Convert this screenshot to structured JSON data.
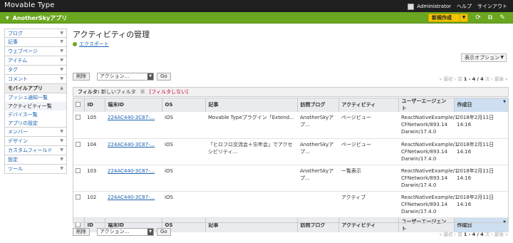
{
  "app": {
    "title": "Movable Type"
  },
  "user": {
    "name": "Administrator",
    "help": "ヘルプ",
    "signout": "サインアウト"
  },
  "blog": {
    "name": "AnotherSkyアプリ",
    "new_button": "新規作成"
  },
  "sidebar": {
    "items": [
      {
        "label": "ブログ"
      },
      {
        "label": "記事"
      },
      {
        "label": "ウェブページ"
      },
      {
        "label": "アイテム"
      },
      {
        "label": "タグ"
      },
      {
        "label": "コメント"
      },
      {
        "label": "モバイルアプリ"
      }
    ],
    "subitems": [
      {
        "label": "プッシュ通知一覧"
      },
      {
        "label": "アクティビティ一覧"
      },
      {
        "label": "デバイス一覧"
      },
      {
        "label": "アプリの設定"
      }
    ],
    "items2": [
      {
        "label": "メンバー"
      },
      {
        "label": "デザイン"
      },
      {
        "label": "カスタムフィールド"
      },
      {
        "label": "設定"
      },
      {
        "label": "ツール"
      }
    ]
  },
  "page": {
    "title": "アクティビティの管理",
    "export": "エクスポート",
    "display_options": "表示オプション"
  },
  "actions": {
    "delete": "削除",
    "select": "アクション...",
    "go": "Go"
  },
  "pager": {
    "first": "« 最初",
    "prev": "‹ 前",
    "range": "1 - 4 / 4",
    "next": "次 ›",
    "last": "最後 »"
  },
  "filter": {
    "label": "フィルタ:",
    "current": "新しいフィルタ",
    "reset": "[フィルタしない]"
  },
  "table": {
    "headers": {
      "id": "ID",
      "device": "端末ID",
      "os": "OS",
      "entry": "記事",
      "blog": "訪問ブログ",
      "activity": "アクティビティ",
      "agent": "ユーザーエージェント",
      "date": "作成日"
    },
    "rows": [
      {
        "id": "105",
        "device": "224AC440-3C87-...",
        "os": "iOS",
        "entry": "Movable Typeプラグイン「Extend...",
        "blog": "AnotherSkyアプ...",
        "activity": "ページビュー",
        "agent": "ReactNativeExample/1 CFNetwork/893.14 Darwin/17.4.0",
        "date": "2018年2月11日 14:16"
      },
      {
        "id": "104",
        "device": "224AC440-3C87-...",
        "os": "iOS",
        "entry": "「ヒロフロ交流会＋忘年会」でアクセシビリティ...",
        "blog": "AnotherSkyアプ...",
        "activity": "ページビュー",
        "agent": "ReactNativeExample/1 CFNetwork/893.14 Darwin/17.4.0",
        "date": "2018年2月11日 14:16"
      },
      {
        "id": "103",
        "device": "224AC440-3C87-...",
        "os": "iOS",
        "entry": "",
        "blog": "AnotherSkyアプ...",
        "activity": "一覧表示",
        "agent": "ReactNativeExample/1 CFNetwork/893.14 Darwin/17.4.0",
        "date": "2018年2月11日 14:16"
      },
      {
        "id": "102",
        "device": "224AC440-3C87-...",
        "os": "iOS",
        "entry": "",
        "blog": "",
        "activity": "アクティブ",
        "agent": "ReactNativeExample/1 CFNetwork/893.14 Darwin/17.4.0",
        "date": "2018年2月11日 14:16"
      }
    ]
  }
}
